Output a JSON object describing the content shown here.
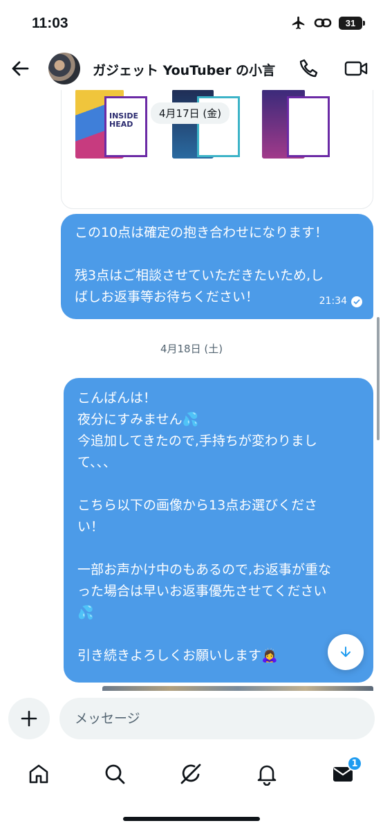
{
  "status": {
    "time": "11:03",
    "battery": "31"
  },
  "header": {
    "title": "ガジェット YouTuber の小言"
  },
  "image_card": {
    "poster_title": "INSIDE HEAD"
  },
  "dates": {
    "first": "4月17日 (金)",
    "second": "4月18日 (土)"
  },
  "messages": [
    {
      "lines": [
        "この10点は確定の抱き合わせになります！",
        "",
        "残3点はご相談させていただきたいため,し",
        "ばしお返事等お待ちください！"
      ],
      "time": "21:34"
    },
    {
      "lines": [
        "こんばんは！",
        "夜分にすみません💦",
        "今追加してきたので,手持ちが変わりまし",
        "て、、、",
        "",
        "こちら以下の画像から13点お選びくださ",
        "い！",
        "",
        "一部お声かけ中のもあるので,お返事が重な",
        "った場合は早いお返事優先させてください",
        "💦",
        "",
        "引き続きよろしくお願いします🙇‍♀️"
      ]
    }
  ],
  "composer": {
    "placeholder": "メッセージ"
  },
  "tabs": {
    "messages_badge": "1"
  },
  "icons": {
    "back": "arrow-left-icon",
    "call": "phone-icon",
    "video": "video-camera-icon",
    "add": "plus-icon",
    "scroll": "arrow-down-icon",
    "home": "home-icon",
    "search": "search-icon",
    "grok": "grok-icon",
    "notifications": "bell-icon",
    "messages": "envelope-icon"
  },
  "colors": {
    "bubble": "#4c9be8",
    "accent": "#1d9bf0"
  }
}
